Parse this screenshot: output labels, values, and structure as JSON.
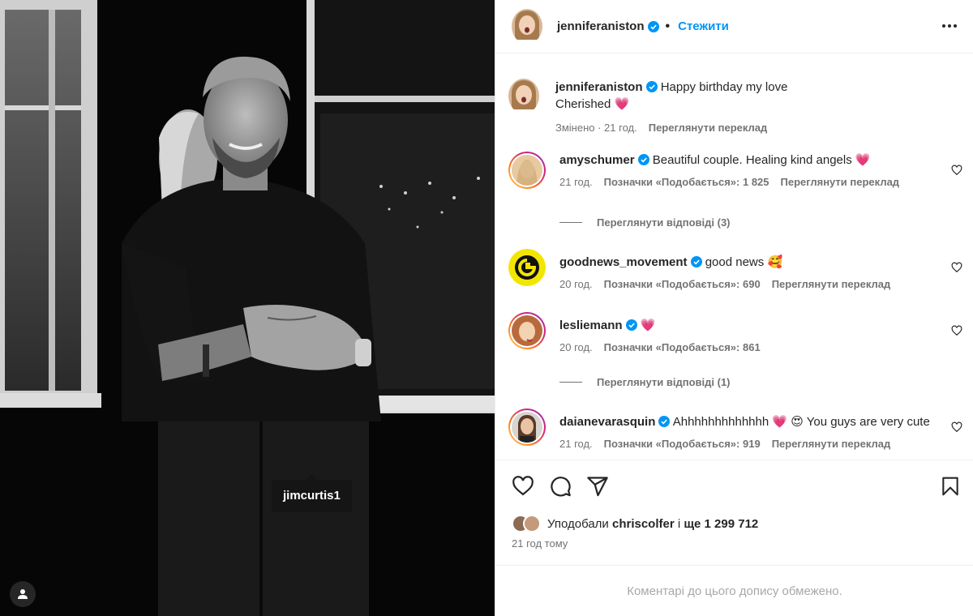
{
  "photo": {
    "tag_label": "jimcurtis1",
    "user_tag_icon": "person-icon"
  },
  "post": {
    "author": "jenniferaniston",
    "follow_label": "Стежити",
    "more_icon": "more-horizontal-icon",
    "caption_line1": "Happy birthday my love",
    "caption_line2": "Cherished",
    "caption_emoji": "💗",
    "caption_meta": "Змінено · 21 год.",
    "caption_translate": "Переглянути переклад"
  },
  "comments": [
    {
      "user": "amyschumer",
      "text": "Beautiful couple. Healing kind angels",
      "emoji": "💗",
      "time": "21 год.",
      "likes": "Позначки «Подобається»: 1 825",
      "translate": "Переглянути переклад",
      "replies": "Переглянути відповіді (3)"
    },
    {
      "user": "goodnews_movement",
      "text": "good news",
      "emoji": "🥰",
      "time": "20 год.",
      "likes": "Позначки «Подобається»: 690",
      "translate": "Переглянути переклад"
    },
    {
      "user": "lesliemann",
      "text": "",
      "emoji": "💗",
      "time": "20 год.",
      "likes": "Позначки «Подобається»: 861",
      "replies": "Переглянути відповіді (1)"
    },
    {
      "user": "daianevarasquin",
      "text": "Ahhhhhhhhhhhhh",
      "emoji": "💗 😍",
      "text2": "You guys are very cute",
      "time": "21 год.",
      "likes": "Позначки «Подобається»: 919",
      "translate": "Переглянути переклад"
    }
  ],
  "actions": {
    "liked_by_prefix": "Уподобали",
    "liked_by_user": "chriscolfer",
    "liked_by_and": "і",
    "liked_by_count": "ще 1 299 712",
    "time_ago": "21 год тому",
    "comments_restricted": "Коментарі до цього допису обмежено."
  },
  "colors": {
    "accent": "#0095f6",
    "verified": "#0095f6",
    "muted": "#737373",
    "restricted": "#a8a8a8"
  }
}
